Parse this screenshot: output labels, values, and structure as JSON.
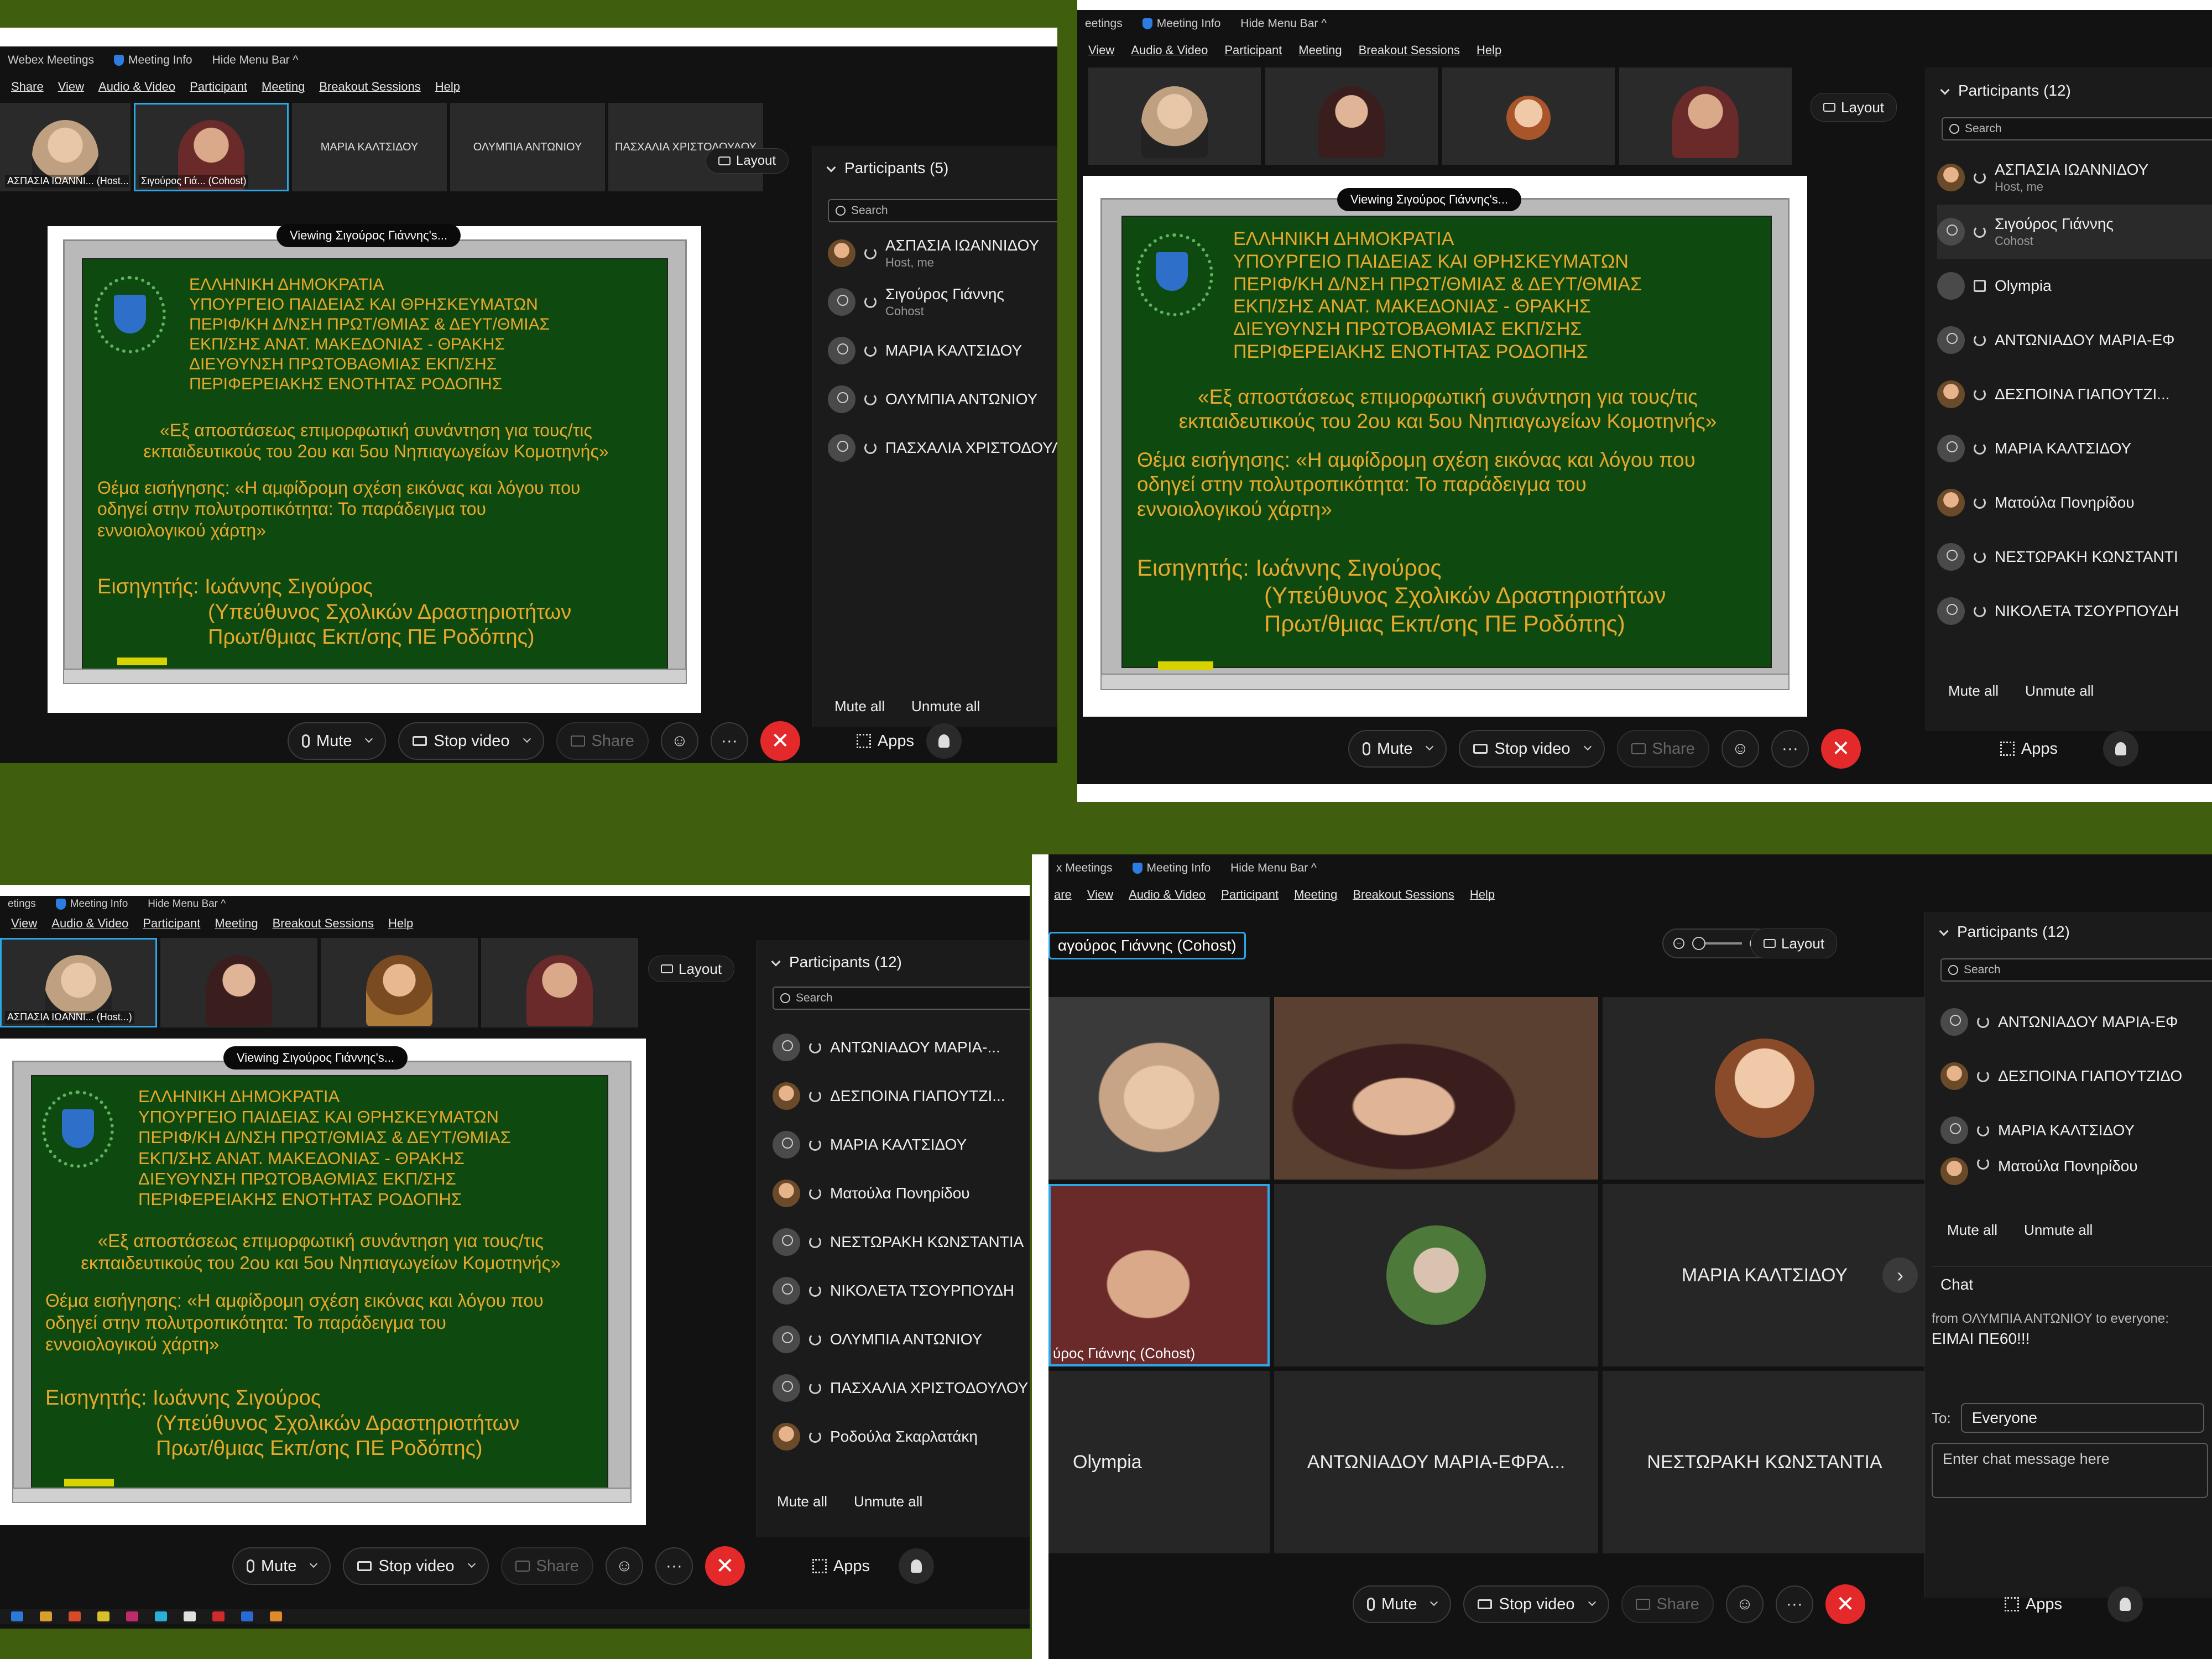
{
  "colors": {
    "background": "#3f5f0f",
    "accent": "#2aa8ea",
    "end_call": "#e32929",
    "board_text": "#e8a82c",
    "board_green": "#0e4a10"
  },
  "slide": {
    "viewing": "Viewing Σιγούρος Γιάννης's...",
    "lines": [
      "ΕΛΛΗΝΙΚΗ ΔΗΜΟΚΡΑΤΙΑ",
      "ΥΠΟΥΡΓΕΙΟ ΠΑΙΔΕΙΑΣ ΚΑΙ ΘΡΗΣΚΕΥΜΑΤΩΝ",
      "ΠΕΡΙΦ/ΚΗ Δ/ΝΣΗ ΠΡΩΤ/ΘΜΙΑΣ & ΔΕΥΤ/ΘΜΙΑΣ",
      "ΕΚΠ/ΣΗΣ ΑΝΑΤ. ΜΑΚΕΔΟΝΙΑΣ - ΘΡΑΚΗΣ",
      "ΔΙΕΥΘΥΝΣΗ ΠΡΩΤΟΒΑΘΜΙΑΣ ΕΚΠ/ΣΗΣ",
      "ΠΕΡΙΦΕΡΕΙΑΚΗΣ ΕΝΟΤΗΤΑΣ ΡΟΔΟΠΗΣ"
    ],
    "meeting_line1": "«Εξ αποστάσεως επιμορφωτική συνάντηση για τους/τις",
    "meeting_line2": "εκπαιδευτικούς του 2ου και 5ου Νηπιαγωγείων Κομοτηνής»",
    "topic_label": "Θέμα εισήγησης:",
    "topic_line1": "«Η αμφίδρομη σχέση εικόνας και λόγου που",
    "topic_line2": "οδηγεί στην πολυτροπικότητα: Το παράδειγμα του",
    "topic_line3": "εννοιολογικού χάρτη»",
    "speaker_label": "Εισηγητής:",
    "speaker_name": "Ιωάννης Σιγούρος",
    "speaker_role1": "(Υπεύθυνος Σχολικών Δραστηριοτήτων",
    "speaker_role2": "Πρωτ/θμιας Εκπ/σης ΠΕ Ροδόπης)"
  },
  "titlebar": {
    "app": "Webex Meetings",
    "app_q2": "eetings",
    "app_q3": "etings",
    "app_q4": "x Meetings",
    "meeting_info": "Meeting Info",
    "hide_menu": "Hide Menu Bar ^"
  },
  "menu": {
    "q1": [
      "Share",
      "View",
      "Audio & Video",
      "Participant",
      "Meeting",
      "Breakout Sessions",
      "Help"
    ],
    "q2": [
      "View",
      "Audio & Video",
      "Participant",
      "Meeting",
      "Breakout Sessions",
      "Help"
    ],
    "q3": [
      "View",
      "Audio & Video",
      "Participant",
      "Meeting",
      "Breakout Sessions",
      "Help"
    ],
    "q4": [
      "are",
      "View",
      "Audio & Video",
      "Participant",
      "Meeting",
      "Breakout Sessions",
      "Help"
    ]
  },
  "controls": {
    "mute": "Mute",
    "stop_video": "Stop video",
    "share": "Share",
    "more": "···",
    "apps": "Apps",
    "end": "✕",
    "reactions": "☺"
  },
  "layout_label": "Layout",
  "q1": {
    "thumbs": [
      "ΑΣΠΑΣΙΑ ΙΩΑΝΝΙ... (Host...)",
      "Σιγούρος Γιά... (Cohost)",
      "ΜΑΡΙΑ ΚΑΛΤΣΙΔΟΥ",
      "ΟΛΥΜΠΙΑ ΑΝΤΩΝΙΟΥ",
      "ΠΑΣΧΑΛΙΑ ΧΡΙΣΤΟΔΟΥΛΟΥ"
    ],
    "participants_title": "Participants (5)",
    "search": "Search",
    "participants": [
      {
        "name": "ΑΣΠΑΣΙΑ ΙΩΑΝΝΙΔΟΥ",
        "sub": "Host, me"
      },
      {
        "name": "Σιγούρος Γιάννης",
        "sub": "Cohost"
      },
      {
        "name": "ΜΑΡΙΑ ΚΑΛΤΣΙΔΟΥ",
        "sub": ""
      },
      {
        "name": "ΟΛΥΜΠΙΑ ΑΝΤΩΝΙΟΥ",
        "sub": ""
      },
      {
        "name": "ΠΑΣΧΑΛΙΑ ΧΡΙΣΤΟΔΟΥΛ",
        "sub": ""
      }
    ],
    "mute_all": "Mute all",
    "unmute_all": "Unmute all"
  },
  "q2": {
    "participants_title": "Participants (12)",
    "search": "Search",
    "participants": [
      {
        "name": "ΑΣΠΑΣΙΑ ΙΩΑΝΝΙΔΟΥ",
        "sub": "Host, me"
      },
      {
        "name": "Σιγούρος Γιάννης",
        "sub": "Cohost"
      },
      {
        "name": "Olympia",
        "sub": ""
      },
      {
        "name": "ΑΝΤΩΝΙΑΔΟΥ ΜΑΡΙΑ-ΕΦ",
        "sub": ""
      },
      {
        "name": "ΔΕΣΠΟΙΝΑ ΓΙΑΠΟΥΤΖΙ...",
        "sub": ""
      },
      {
        "name": "ΜΑΡΙΑ ΚΑΛΤΣΙΔΟΥ",
        "sub": ""
      },
      {
        "name": "Ματούλα Πονηρίδου",
        "sub": ""
      },
      {
        "name": "ΝΕΣΤΩΡΑΚΗ ΚΩΝΣΤΑΝΤΙ",
        "sub": ""
      },
      {
        "name": "ΝΙΚΟΛΕΤΑ ΤΣΟΥΡΠΟΥΔΗ",
        "sub": ""
      }
    ],
    "mute_all": "Mute all",
    "unmute_all": "Unmute all"
  },
  "q3": {
    "thumb_name": "ΑΣΠΑΣΙΑ ΙΩΑΝΝΙ... (Host...)",
    "participants_title": "Participants (12)",
    "search": "Search",
    "participants": [
      {
        "name": "ΑΝΤΩΝΙΑΔΟΥ ΜΑΡΙΑ-...",
        "sub": ""
      },
      {
        "name": "ΔΕΣΠΟΙΝΑ ΓΙΑΠΟΥΤΖΙ...",
        "sub": ""
      },
      {
        "name": "ΜΑΡΙΑ ΚΑΛΤΣΙΔΟΥ",
        "sub": ""
      },
      {
        "name": "Ματούλα Πονηρίδου",
        "sub": ""
      },
      {
        "name": "ΝΕΣΤΩΡΑΚΗ ΚΩΝΣΤΑΝΤΙΑ",
        "sub": ""
      },
      {
        "name": "ΝΙΚΟΛΕΤΑ ΤΣΟΥΡΠΟΥΔΗ",
        "sub": ""
      },
      {
        "name": "ΟΛΥΜΠΙΑ ΑΝΤΩΝΙΟΥ",
        "sub": ""
      },
      {
        "name": "ΠΑΣΧΑΛΙΑ ΧΡΙΣΤΟΔΟΥΛΟΥ",
        "sub": ""
      },
      {
        "name": "Ροδούλα Σκαρλατάκη",
        "sub": ""
      }
    ],
    "mute_all": "Mute all",
    "unmute_all": "Unmute all"
  },
  "q4": {
    "cohost_chip": "αγούρος Γιάννης (Cohost)",
    "grid": {
      "cell4_name": "ύρος Γιάννης (Cohost)",
      "maria": "ΜΑΡΙΑ ΚΑΛΤΣΙΔΟΥ",
      "olympia": "Olympia",
      "antoniadou": "ΑΝΤΩΝΙΑΔΟΥ ΜΑΡΙΑ-ΕΦΡΑ...",
      "nestoraki": "ΝΕΣΤΩΡΑΚΗ ΚΩΝΣΤΑΝΤΙΑ"
    },
    "participants_title": "Participants (12)",
    "search": "Search",
    "participants": [
      {
        "name": "ΑΝΤΩΝΙΑΔΟΥ ΜΑΡΙΑ-ΕΦ",
        "sub": ""
      },
      {
        "name": "ΔΕΣΠΟΙΝΑ ΓΙΑΠΟΥΤΖΙΔΟ",
        "sub": ""
      },
      {
        "name": "ΜΑΡΙΑ ΚΑΛΤΣΙΔΟΥ",
        "sub": ""
      },
      {
        "name": "Ματούλα Πονηρίδου",
        "sub": ""
      }
    ],
    "mute_all": "Mute all",
    "unmute_all": "Unmute all",
    "chat": {
      "title": "Chat",
      "from": "from ΟΛΥΜΠΙΑ ΑΝΤΩΝΙΟΥ to everyone:",
      "message": "ΕΙΜΑΙ ΠΕ60!!!",
      "to_label": "To:",
      "to_value": "Everyone",
      "placeholder": "Enter chat message here"
    }
  }
}
